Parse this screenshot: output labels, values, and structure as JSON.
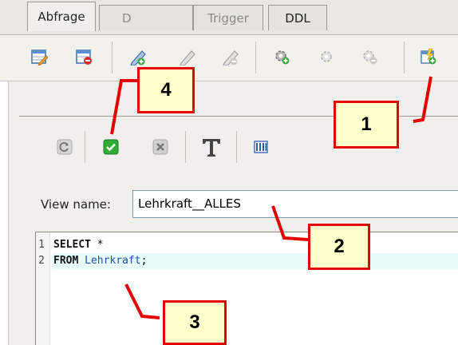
{
  "toolbar": {
    "buttons": [
      {
        "name": "edit-table-icon"
      },
      {
        "name": "delete-table-icon"
      },
      {
        "name": "edit-pencil-icon"
      },
      {
        "name": "edit-pencil-disabled-icon"
      },
      {
        "name": "remove-pencil-disabled-icon"
      },
      {
        "name": "add-gear-icon"
      },
      {
        "name": "gear-disabled-icon"
      },
      {
        "name": "remove-gear-disabled-icon"
      },
      {
        "name": "create-view-icon"
      }
    ]
  },
  "tabs": [
    {
      "label": "Abfrage",
      "active": true
    },
    {
      "label": "D",
      "active": false
    },
    {
      "label": "Trigger",
      "active": false
    },
    {
      "label": "DDL",
      "active": false
    }
  ],
  "sql_toolbar": {
    "icons": [
      "refresh-icon",
      "check-icon",
      "cancel-icon",
      "text-format-icon",
      "columns-icon"
    ]
  },
  "view": {
    "label": "View name:",
    "value": "Lehrkraft__ALLES"
  },
  "editor": {
    "line_numbers": [
      "1",
      "2"
    ],
    "lines": [
      {
        "keyword": "SELECT",
        "rest": " *"
      },
      {
        "keyword": "FROM",
        "ident": "Lehrkraft",
        "rest": ";"
      }
    ]
  },
  "callouts": [
    "1",
    "2",
    "3",
    "4"
  ],
  "colors": {
    "callout_border": "#e40000",
    "callout_fill": "#ffffcc",
    "identifier": "#1f4fb8"
  }
}
